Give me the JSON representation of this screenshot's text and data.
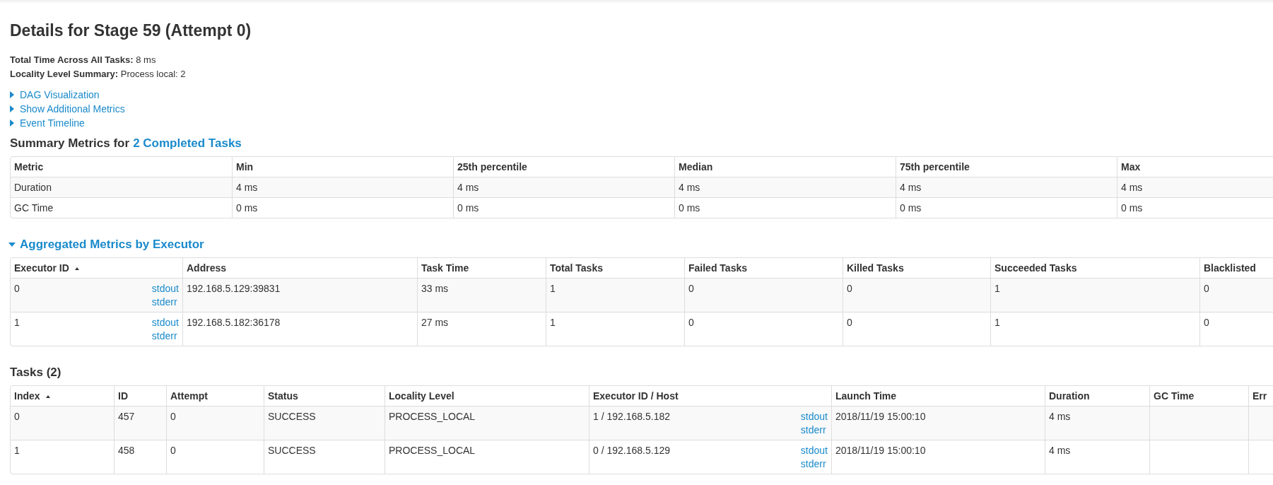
{
  "title": "Details for Stage 59 (Attempt 0)",
  "summary": [
    {
      "label": "Total Time Across All Tasks:",
      "value": "8 ms"
    },
    {
      "label": "Locality Level Summary:",
      "value": "Process local: 2"
    }
  ],
  "toggles": [
    {
      "label": "DAG Visualization",
      "expanded": false
    },
    {
      "label": "Show Additional Metrics",
      "expanded": false
    },
    {
      "label": "Event Timeline",
      "expanded": false
    }
  ],
  "summary_metrics": {
    "heading": "Summary Metrics for",
    "link": "2 Completed Tasks",
    "columns": [
      {
        "label": "Metric",
        "sorted": false
      },
      {
        "label": "Min",
        "sorted": false
      },
      {
        "label": "25th percentile",
        "sorted": false
      },
      {
        "label": "Median",
        "sorted": false
      },
      {
        "label": "75th percentile",
        "sorted": false
      },
      {
        "label": "Max",
        "sorted": false
      }
    ],
    "rows": [
      {
        "cells": [
          "Duration",
          "4 ms",
          "4 ms",
          "4 ms",
          "4 ms",
          "4 ms"
        ]
      },
      {
        "cells": [
          "GC Time",
          "0 ms",
          "0 ms",
          "0 ms",
          "0 ms",
          "0 ms"
        ]
      }
    ]
  },
  "executors": {
    "heading": "Aggregated Metrics by Executor",
    "expanded": true,
    "columns": [
      {
        "label": "Executor ID",
        "kind": "logs",
        "sorted": true
      },
      {
        "label": "Address",
        "kind": "plain",
        "sorted": false
      },
      {
        "label": "Task Time",
        "kind": "plain",
        "sorted": false
      },
      {
        "label": "Total Tasks",
        "kind": "plain",
        "sorted": false
      },
      {
        "label": "Failed Tasks",
        "kind": "plain",
        "sorted": false
      },
      {
        "label": "Killed Tasks",
        "kind": "plain",
        "sorted": false
      },
      {
        "label": "Succeeded Tasks",
        "kind": "plain",
        "sorted": false
      },
      {
        "label": "Blacklisted",
        "kind": "plain",
        "sorted": false
      }
    ],
    "rows": [
      {
        "cells": [
          "0",
          "192.168.5.129:39831",
          "33 ms",
          "1",
          "0",
          "0",
          "1",
          "0"
        ],
        "logs": [
          "stdout",
          "stderr"
        ]
      },
      {
        "cells": [
          "1",
          "192.168.5.182:36178",
          "27 ms",
          "1",
          "0",
          "0",
          "1",
          "0"
        ],
        "logs": [
          "stdout",
          "stderr"
        ]
      }
    ]
  },
  "tasks": {
    "heading": "Tasks (2)",
    "columns": [
      {
        "label": "Index",
        "kind": "plain",
        "sorted": true
      },
      {
        "label": "ID",
        "kind": "plain",
        "sorted": false
      },
      {
        "label": "Attempt",
        "kind": "plain",
        "sorted": false
      },
      {
        "label": "Status",
        "kind": "plain",
        "sorted": false
      },
      {
        "label": "Locality Level",
        "kind": "plain",
        "sorted": false
      },
      {
        "label": "Executor ID / Host",
        "kind": "logs",
        "sorted": false
      },
      {
        "label": "Launch Time",
        "kind": "plain",
        "sorted": false
      },
      {
        "label": "Duration",
        "kind": "plain",
        "sorted": false
      },
      {
        "label": "GC Time",
        "kind": "plain",
        "sorted": false
      },
      {
        "label": "Err",
        "kind": "plain"
      }
    ],
    "rows": [
      {
        "cells": [
          "0",
          "457",
          "0",
          "SUCCESS",
          "PROCESS_LOCAL",
          "1 / 192.168.5.182",
          "2018/11/19 15:00:10",
          "4 ms",
          "",
          ""
        ],
        "logs": [
          "stdout",
          "stderr"
        ]
      },
      {
        "cells": [
          "1",
          "458",
          "0",
          "SUCCESS",
          "PROCESS_LOCAL",
          "0 / 192.168.5.129",
          "2018/11/19 15:00:10",
          "4 ms",
          "",
          ""
        ],
        "logs": [
          "stdout",
          "stderr"
        ]
      }
    ]
  }
}
